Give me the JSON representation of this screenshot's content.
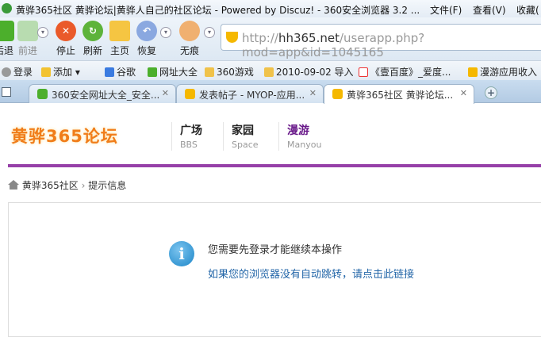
{
  "window": {
    "title": "黄骅365社区 黄骅论坛|黄骅人自己的社区论坛 - Powered by Discuz! - 360安全浏览器 3.2 ...",
    "menus": [
      "文件(F)",
      "查看(V)",
      "收藏("
    ]
  },
  "toolbar": {
    "back": "后退",
    "forward": "前进",
    "stop": "停止",
    "refresh": "刷新",
    "home": "主页",
    "restore": "恢复",
    "incognito": "无痕"
  },
  "address": {
    "prefix": "http://",
    "host": "hh365.net",
    "path": "/userapp.php?mod=app&id=1045165"
  },
  "bookmarks": [
    "登录",
    "添加",
    "谷歌",
    "网址大全",
    "360游戏",
    "2010-09-02 导入",
    "《壹百度》_爱度...",
    "漫游应用收入"
  ],
  "tabs": [
    {
      "label": "360安全网址大全_安全..."
    },
    {
      "label": "发表帖子 - MYOP-应用..."
    },
    {
      "label": "黄骅365社区 黄骅论坛..."
    }
  ],
  "site": {
    "logo": "黄骅365论坛",
    "nav": [
      {
        "cn": "广场",
        "en": "BBS"
      },
      {
        "cn": "家园",
        "en": "Space"
      },
      {
        "cn": "漫游",
        "en": "Manyou"
      }
    ],
    "accent": "#9640a8"
  },
  "breadcrumb": {
    "home": "黄骅365社区",
    "sep": "›",
    "current": "提示信息"
  },
  "notice": {
    "message": "您需要先登录才能继续本操作",
    "link": "如果您的浏览器没有自动跳转，请点击此链接"
  }
}
